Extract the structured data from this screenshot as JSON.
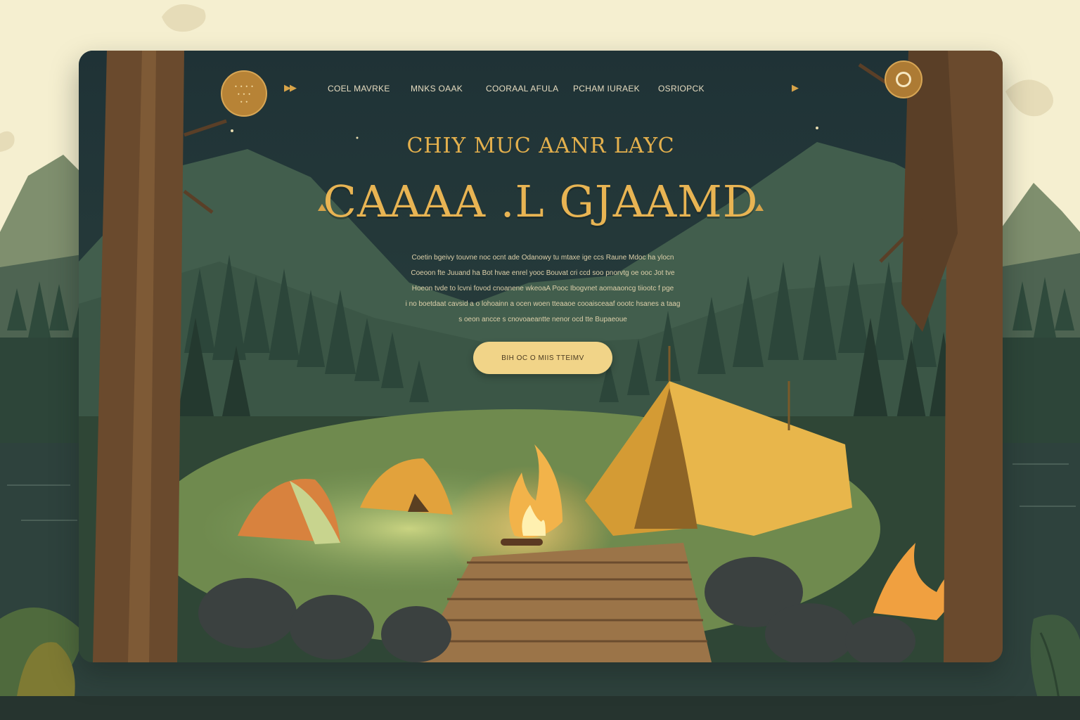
{
  "logo": {
    "line1": "⬩ ⬩ ⬩ ⬩",
    "line2": "⬩ ⬩ ⬩",
    "line3": "⬩ ⬩"
  },
  "nav": {
    "items": [
      {
        "label": "COEL MAVRKE"
      },
      {
        "label": "MNKS  OAAK"
      },
      {
        "label": "COORAAL AFULA"
      },
      {
        "label": "PCHAM IURAEK"
      },
      {
        "label": "OSRIOPCK"
      }
    ],
    "menu_icon": "ring-icon"
  },
  "hero": {
    "eyebrow": "CHIY MUC AANR LAYC",
    "title": "CAAAA .L GJAAMD",
    "body_lines": [
      "Coetin bgeivy touvne noc ocnt ade Odanowy tu mtaxe ige ccs Raune Mdoc ha ylocn",
      "Coeoon fte Juuand ha Bot hvae enrel yooc Bouvat cri ccd soo pnorvtg oe ooc Jot tve",
      "Hoeon tvde to lcvni fovod cnoanene wkeoaA Pooc Ibogvnet aomaaoncg tiiootc f pge",
      "i no boetdaat cavsid a o lohoainn a ocen woen tteaaoe cooaisceaaf oootc hsanes a taag",
      "s oeon ancce s cnovoaeantte nenor ocd tte Bupaeoue"
    ],
    "cta_label": "BIH OC O MIIS TTEIMV"
  }
}
